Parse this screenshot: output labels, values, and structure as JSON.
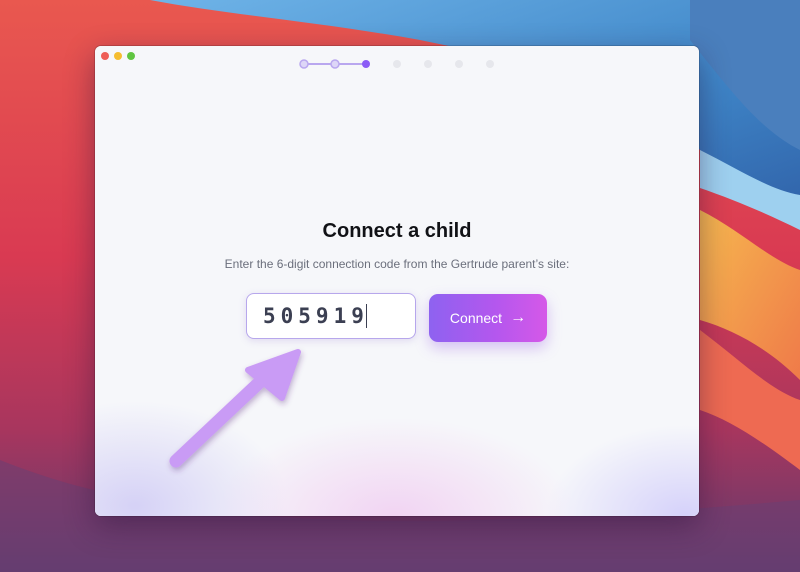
{
  "dialog": {
    "title": "Connect a child",
    "subtitle": "Enter the 6-digit connection code from the Gertrude parent’s site:",
    "code_value": "505919",
    "connect_label": "Connect",
    "connect_icon": "→"
  },
  "stepper": {
    "total_steps": 7,
    "current_step": 3
  },
  "colors": {
    "accent": "#8b5cf6",
    "button_gradient_start": "#8e62f0",
    "button_gradient_end": "#d558e8",
    "annotation_arrow": "#c99bf5"
  }
}
